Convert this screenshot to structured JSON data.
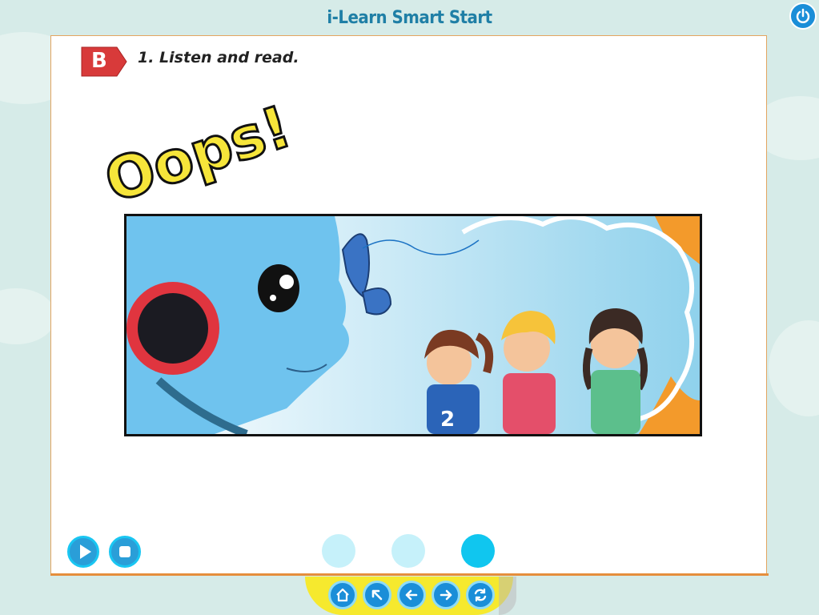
{
  "app": {
    "title": "i-Learn Smart Start"
  },
  "header": {
    "power_icon": "power-icon"
  },
  "lesson": {
    "section_letter": "B",
    "instruction": "1. Listen and read."
  },
  "comic": {
    "exclamation": "Oops!",
    "shirt_number": "2"
  },
  "audio_controls": {
    "play_icon": "play-icon",
    "stop_icon": "stop-icon"
  },
  "pagination": {
    "pages": [
      {
        "index": 1,
        "active": false
      },
      {
        "index": 2,
        "active": false
      },
      {
        "index": 3,
        "active": true
      }
    ]
  },
  "bottom_nav": {
    "buttons": [
      "home-icon",
      "arrow-up-left-icon",
      "arrow-left-icon",
      "arrow-right-icon",
      "refresh-icon"
    ]
  },
  "colors": {
    "accent_blue": "#1a8ed8",
    "panel_border": "#e3a560",
    "badge_red": "#d83a3a",
    "nav_yellow": "#f6e92e",
    "active_dot": "#10c6ef"
  }
}
